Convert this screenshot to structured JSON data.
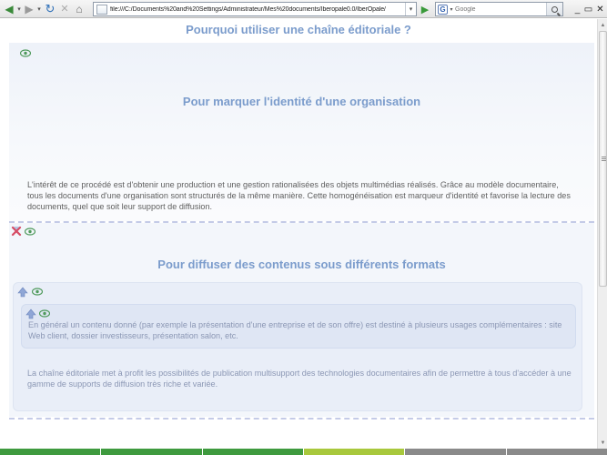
{
  "browser": {
    "url": "file:///C:/Documents%20and%20Settings/Administrateur/Mes%20documents/Iberopale0.0/IberOpale/",
    "search_placeholder": "Google",
    "search_engine_letter": "G"
  },
  "page": {
    "title": "Pourquoi utiliser une chaîne éditoriale ?",
    "sections": [
      {
        "title": "Pour marquer l'identité d'une organisation",
        "text": "L'intérêt de ce procédé est d'obtenir une production et une gestion rationalisées des objets multimédias réalisés. Grâce au modèle documentaire, tous les documents d'une organisation sont structurés de la même manière. Cette homogénéisation est marqueur d'identité et favorise la lecture des documents, quel que soit leur support de diffusion."
      },
      {
        "title": "Pour diffuser des contenus sous différents formats",
        "inner_text": "En général un contenu donné (par exemple la présentation d'une entreprise et de son offre) est destiné à plusieurs usages complémentaires : site Web client, dossier investisseurs, présentation salon, etc.",
        "box_text": "La chaîne éditoriale met à profit les possibilités de publication multisupport des technologies documentaires afin de permettre à tous d'accéder à une gamme de supports de diffusion très riche et variée."
      }
    ]
  },
  "bottom_tabs": [
    {
      "color": "#3e9a3e"
    },
    {
      "color": "#3e9a3e"
    },
    {
      "color": "#3e9a3e"
    },
    {
      "color": "#a8c83c"
    },
    {
      "color": "#8a8a8a"
    },
    {
      "color": "#8a8a8a"
    }
  ],
  "colors": {
    "title": "#7b9ccc",
    "body_text": "#5f5f5f",
    "muted_text": "#8b97b4",
    "section_bg": "#f3f6fb"
  }
}
